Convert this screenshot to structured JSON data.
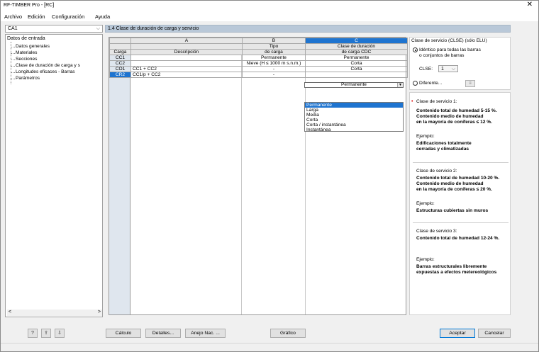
{
  "window": {
    "title": "RF-TIMBER Pro - [RC]",
    "close": "✕"
  },
  "menu": [
    "Archivo",
    "Edición",
    "Configuración",
    "Ayuda"
  ],
  "case_select": {
    "value": "CA1",
    "arrow": "⌵"
  },
  "tree": {
    "root": "Datos de entrada",
    "items": [
      "Datos generales",
      "Materiales",
      "Secciones",
      "Clase de duración de carga y s",
      "Longitudes eficaces - Barras",
      "Parámetros"
    ],
    "scroll_left": "<",
    "scroll_right": ">"
  },
  "section_header": "1.4 Clase de duración de carga y servicio",
  "table": {
    "col_letters": [
      "A",
      "B",
      "C"
    ],
    "head1": [
      "",
      "Tipo",
      "Clase de duración"
    ],
    "head2": [
      "Carga",
      "Descripción",
      "de carga",
      "de carga CDC"
    ],
    "rows": [
      {
        "id": "CC1",
        "desc": "",
        "tipo": "Permanente",
        "cdc": "Permanente"
      },
      {
        "id": "CC2",
        "desc": "",
        "tipo": "Nieve (H ≤ 1000 m s.n.m.)",
        "cdc": "Corta"
      },
      {
        "id": "CO1",
        "desc": "CC1 + CC2",
        "tipo": "-",
        "cdc": "Corta"
      },
      {
        "id": "CR2",
        "desc": "CC1/p + CC2",
        "tipo": "-",
        "cdc": "Permanente"
      }
    ]
  },
  "dropdown": {
    "selected": "Permanente",
    "options": [
      "Permanente",
      "Larga",
      "Media",
      "Corta",
      "Corta / instantánea",
      "Instantánea"
    ]
  },
  "service": {
    "title": "Clase de servicio (CLSE) (sólo ELU)",
    "opt_identical_1": "Idéntico para todas las barras",
    "opt_identical_2": "o conjuntos de barras",
    "clse_label": "CLSE:",
    "clse_value": "1",
    "opt_different": "Diferente...",
    "classes": [
      {
        "title": "Clase de servicio 1:",
        "lines": [
          "Contenido total de humedad 5-15 %.",
          "Contenido medio de humedad",
          "en la mayoría de coníferas ≤ 12 %."
        ],
        "ex_label": "Ejemplo:",
        "ex_lines": [
          "Edificaciones totalmente",
          "cerradas y climatizadas"
        ]
      },
      {
        "title": "Clase de servicio 2:",
        "lines": [
          "Contenido total de humedad 10-20 %.",
          "Contenido medio de humedad",
          "en la mayoría de coníferas ≤ 20 %."
        ],
        "ex_label": "Ejemplo:",
        "ex_lines": [
          "Estructuras cubiertas sin muros"
        ]
      },
      {
        "title": "Clase de servicio 3:",
        "lines": [
          "Contenido total de humedad 12-24 %."
        ],
        "ex_label": "Ejemplo:",
        "ex_lines": [
          "Barras estructurales libremente",
          "expuestas a efectos metereológicos"
        ]
      }
    ]
  },
  "buttons": {
    "calc": "Cálculo",
    "details": "Detalles...",
    "annex": "Anejo Nac. ...",
    "graph": "Gráfico",
    "ok": "Aceptar",
    "cancel": "Cancelar"
  },
  "colors": {
    "selection": "#1e74d0",
    "header": "#b9c8d8"
  }
}
